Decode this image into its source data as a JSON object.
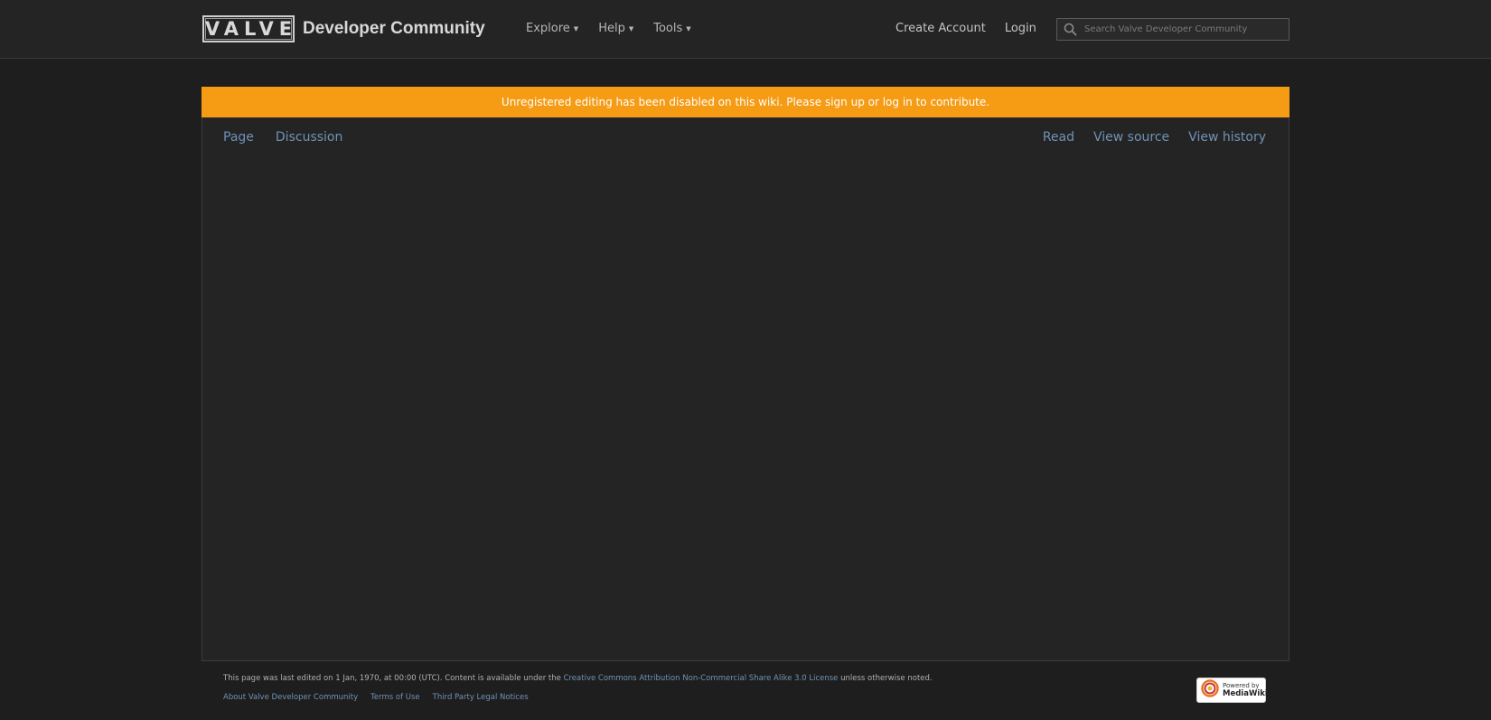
{
  "header": {
    "logo_text": "VALVE",
    "site_name": "Developer Community",
    "nav": [
      {
        "label": "Explore"
      },
      {
        "label": "Help"
      },
      {
        "label": "Tools"
      }
    ],
    "caret": "▼",
    "account": {
      "create_account": "Create Account",
      "login": "Login"
    },
    "search": {
      "placeholder": "Search Valve Developer Community",
      "value": ""
    }
  },
  "banner": {
    "text": "Unregistered editing has been disabled on this wiki. Please sign up or log in to contribute."
  },
  "tabs": {
    "left": [
      {
        "label": "Page"
      },
      {
        "label": "Discussion"
      }
    ],
    "right": [
      {
        "label": "Read"
      },
      {
        "label": "View source"
      },
      {
        "label": "View history"
      }
    ]
  },
  "footer": {
    "last_edited_prefix": "This page was last edited on 1 Jan, 1970, at 00:00 (UTC). Content is available under the ",
    "license_link": "Creative Commons Attribution Non-Commercial Share Alike 3.0 License",
    "license_suffix": " unless otherwise noted.",
    "links": [
      {
        "label": "About Valve Developer Community"
      },
      {
        "label": "Terms of Use"
      },
      {
        "label": "Third Party Legal Notices"
      }
    ],
    "powered_small": "Powered by",
    "powered_big": "MediaWiki"
  },
  "colors": {
    "background": "#1e1e1e",
    "header": "#242424",
    "banner": "#f59b14",
    "link": "#6f93b5"
  }
}
